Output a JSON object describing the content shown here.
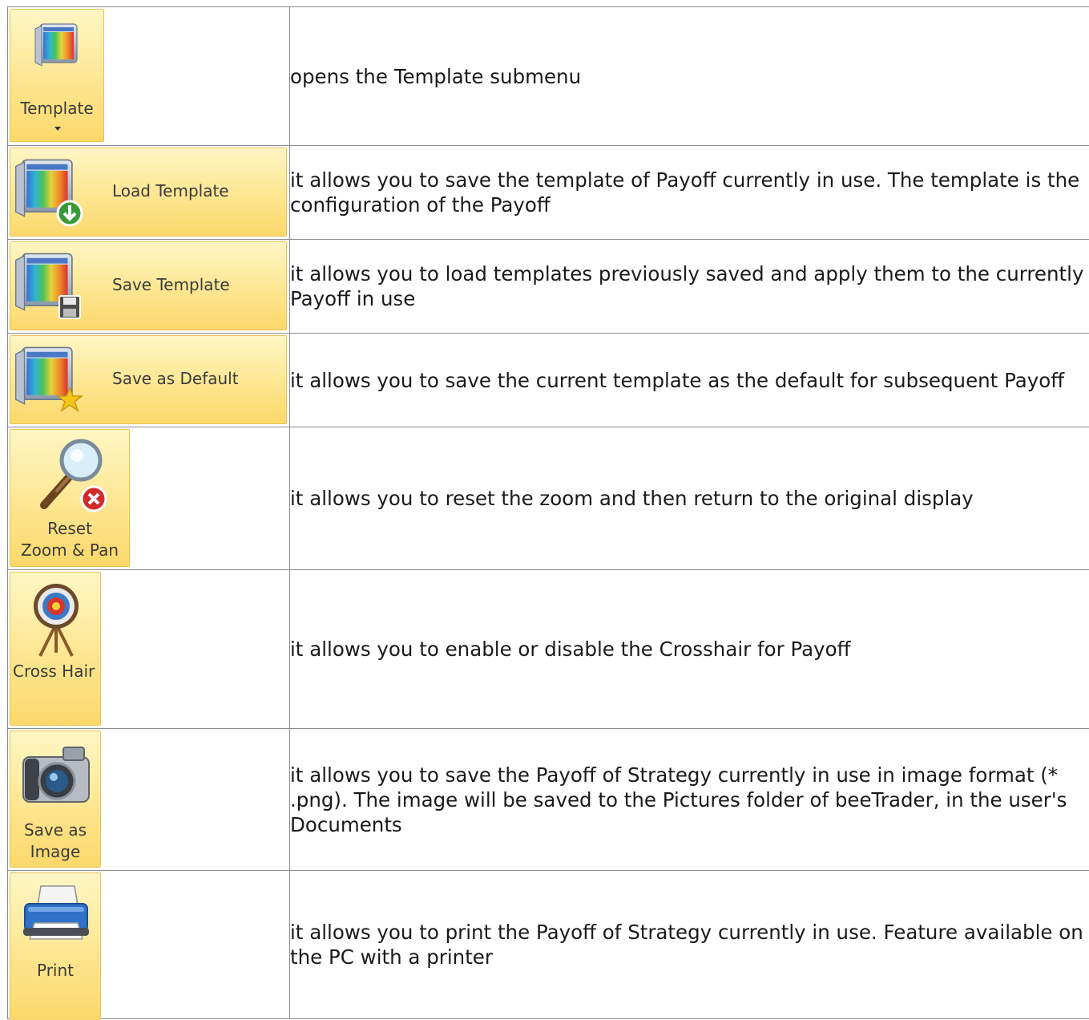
{
  "rows": [
    {
      "button": {
        "label": "Template",
        "icon": "template-icon"
      },
      "description": "opens the Template submenu"
    },
    {
      "button": {
        "label": "Load Template",
        "icon": "load-template-icon"
      },
      "description": "it allows you to save the template of Payoff currently in use. The template is the configuration of the Payoff"
    },
    {
      "button": {
        "label": "Save Template",
        "icon": "save-template-icon"
      },
      "description": "it allows you to load templates previously saved and apply them to the currently Payoff in use"
    },
    {
      "button": {
        "label": "Save as Default",
        "icon": "save-as-default-icon"
      },
      "description": "it allows you to save the current template as the default for subsequent Payoff"
    },
    {
      "button": {
        "label_line1": "Reset",
        "label_line2": "Zoom & Pan",
        "icon": "reset-zoom-icon"
      },
      "description": "it allows you to reset the zoom and then return to the original display"
    },
    {
      "button": {
        "label": "Cross Hair",
        "icon": "crosshair-target-icon"
      },
      "description": "it allows you to enable or disable the Crosshair for Payoff"
    },
    {
      "button": {
        "label_line1": "Save as",
        "label_line2": "Image",
        "icon": "camera-icon"
      },
      "description": "it allows you to save the Payoff of Strategy currently in use in image format (* .png). The image will be saved to the Pictures folder of beeTrader, in the user's Documents"
    },
    {
      "button": {
        "label": "Print",
        "icon": "printer-icon"
      },
      "description": "it allows you to print the Payoff of Strategy currently in use. Feature available on the PC with a printer"
    }
  ],
  "colors": {
    "button_bg_top": "#fff6c4",
    "button_bg_bottom": "#fbd86a",
    "button_border": "#e8c25a",
    "cell_border": "#8c8c8c"
  }
}
